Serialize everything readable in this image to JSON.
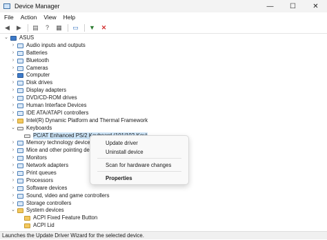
{
  "window": {
    "title": "Device Manager",
    "controls": {
      "minimize": "—",
      "maximize": "☐",
      "close": "✕"
    }
  },
  "menu": [
    "File",
    "Action",
    "View",
    "Help"
  ],
  "toolbar": {
    "buttons": [
      "back-icon",
      "forward-icon",
      "properties-icon",
      "help-icon",
      "update-driver-icon",
      "scan-icon",
      "disable-icon",
      "uninstall-icon"
    ]
  },
  "tree": {
    "root": "ASUS",
    "categories": [
      "Audio inputs and outputs",
      "Batteries",
      "Bluetooth",
      "Cameras",
      "Computer",
      "Disk drives",
      "Display adapters",
      "DVD/CD-ROM drives",
      "Human Interface Devices",
      "IDE ATA/ATAPI controllers",
      "Intel(R) Dynamic Platform and Thermal Framework",
      "Keyboards",
      "PC/AT Enhanced PS/2 Keyboard (101/102-Key)",
      "Memory technology devices",
      "Mice and other pointing devices",
      "Monitors",
      "Network adapters",
      "Print queues",
      "Processors",
      "Software devices",
      "Sound, video and game controllers",
      "Storage controllers",
      "System devices",
      "ACPI Fixed Feature Button",
      "ACPI Lid"
    ]
  },
  "context_menu": {
    "update": "Update driver",
    "uninstall": "Uninstall device",
    "scan": "Scan for hardware changes",
    "properties": "Properties"
  },
  "status": "Launches the Update Driver Wizard for the selected device."
}
